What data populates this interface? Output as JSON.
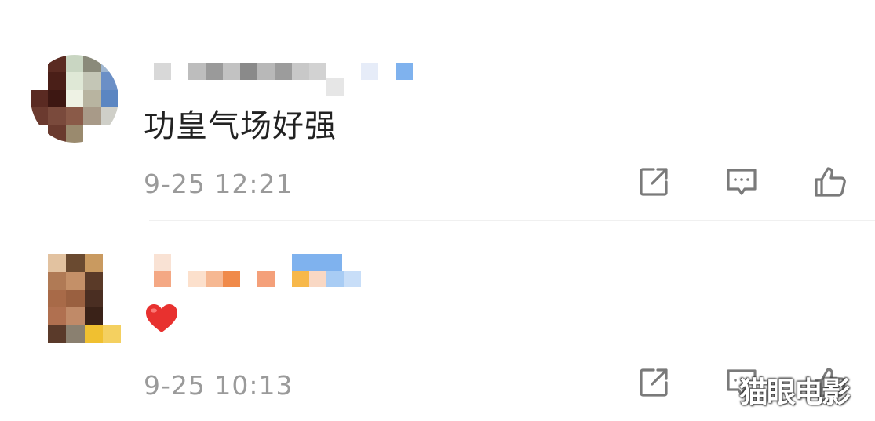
{
  "comments": [
    {
      "text": "功皇气场好强",
      "timestamp": "9-25 12:21",
      "avatar_icon": "pixelated-avatar",
      "username_redacted": true
    },
    {
      "text": "",
      "emoji": "red-heart",
      "timestamp": "9-25 10:13",
      "avatar_icon": "pixelated-avatar",
      "username_redacted": true
    }
  ],
  "actions": {
    "share_icon": "share-icon",
    "reply_icon": "comment-icon",
    "like_icon": "thumbs-up-icon"
  },
  "watermark": "猫眼电影",
  "colors": {
    "text": "#222222",
    "meta": "#9a9a9a",
    "icon": "#7a7a7a",
    "heart": "#e8312f"
  }
}
